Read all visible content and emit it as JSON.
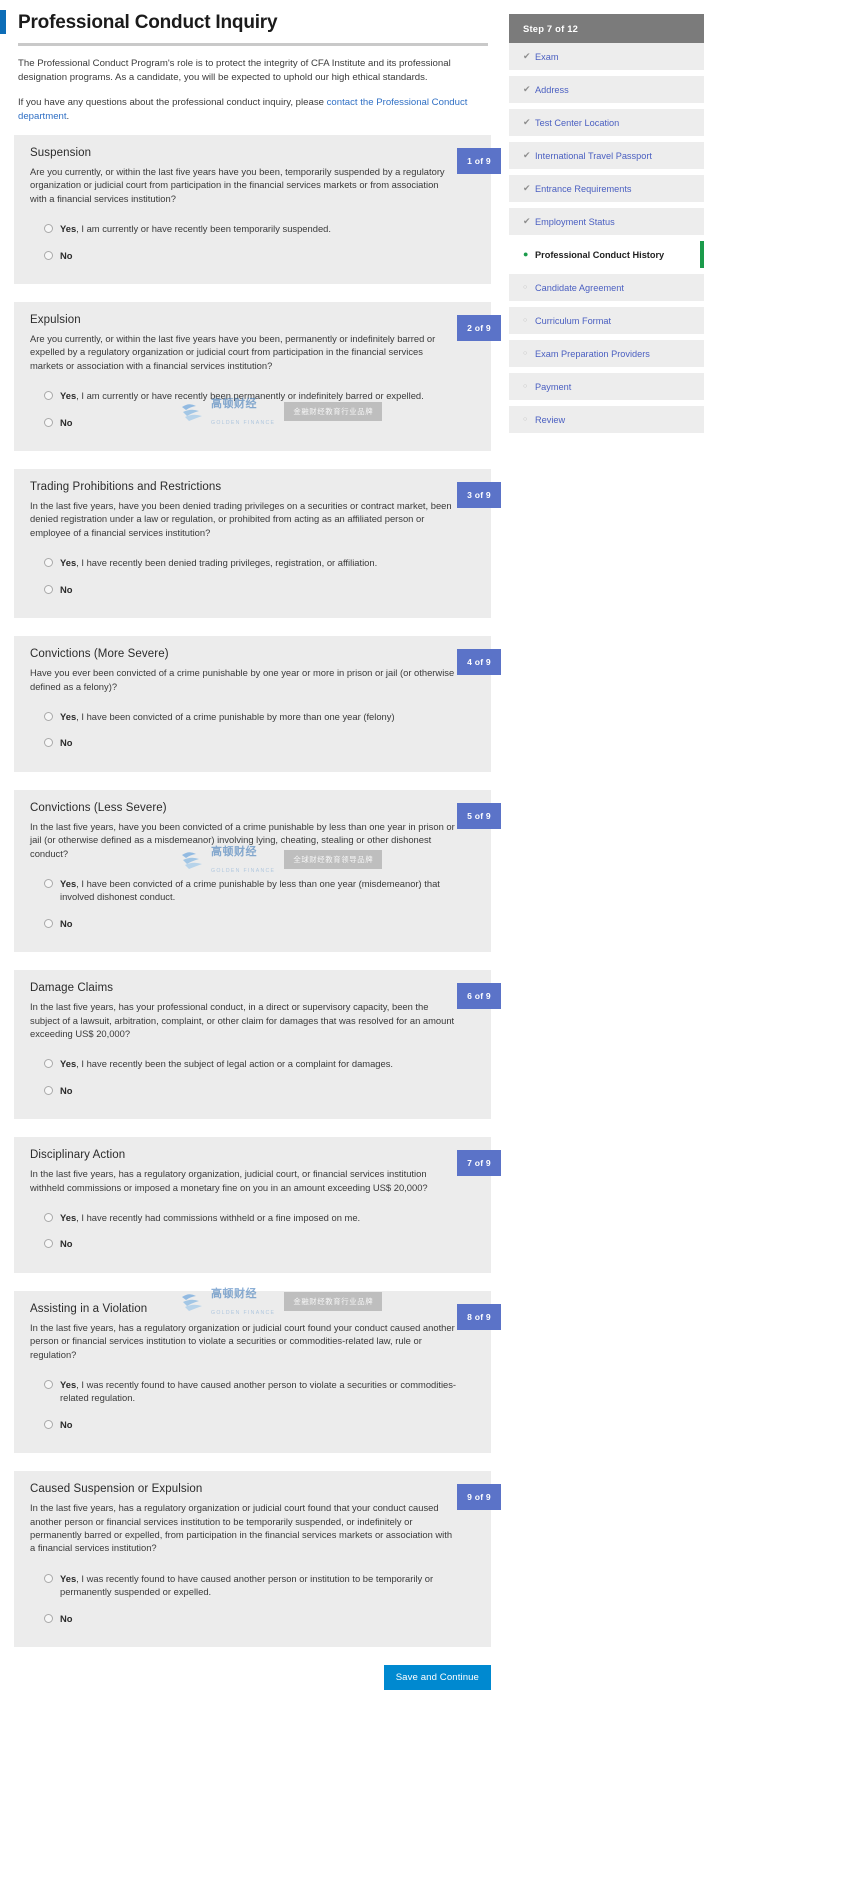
{
  "page": {
    "title": "Professional Conduct Inquiry",
    "intro_paragraph_1": "The Professional Conduct Program's role is to protect the integrity of CFA Institute and its professional designation programs. As a candidate, you will be expected to uphold our high ethical standards.",
    "intro_paragraph_2_prefix": "If you have any questions about the professional conduct inquiry, please ",
    "intro_link_text": "contact the Professional Conduct department",
    "intro_paragraph_2_suffix": "."
  },
  "questions": [
    {
      "badge": "1 of 9",
      "heading": "Suspension",
      "text": "Are you currently, or within the last five years have you been, temporarily suspended by a regulatory organization or judicial court from participation in the financial services markets or from association with a financial services institution?",
      "yes_bold": "Yes",
      "yes_rest": ", I am currently or have recently been temporarily suspended.",
      "no_label": "No"
    },
    {
      "badge": "2 of 9",
      "heading": "Expulsion",
      "text": "Are you currently, or within the last five years have you been, permanently or indefinitely barred or expelled by a regulatory organization or judicial court from participation in the financial services markets or association with a financial services institution?",
      "yes_bold": "Yes",
      "yes_rest": ", I am currently or have recently been permanently or indefinitely barred or expelled.",
      "no_label": "No"
    },
    {
      "badge": "3 of 9",
      "heading": "Trading Prohibitions and Restrictions",
      "text": "In the last five years, have you been denied trading privileges on a securities or contract market, been denied registration under a law or regulation, or prohibited from acting as an affiliated person or employee of a financial services institution?",
      "yes_bold": "Yes",
      "yes_rest": ", I have recently been denied trading privileges, registration, or affiliation.",
      "no_label": "No"
    },
    {
      "badge": "4 of 9",
      "heading": "Convictions (More Severe)",
      "text": "Have you ever been convicted of a crime punishable by one year or more in prison or jail (or otherwise defined as a felony)?",
      "yes_bold": "Yes",
      "yes_rest": ", I have been convicted of a crime punishable by more than one year (felony)",
      "no_label": "No"
    },
    {
      "badge": "5 of 9",
      "heading": "Convictions (Less Severe)",
      "text": "In the last five years, have you been convicted of a crime punishable by less than one year in prison or jail (or otherwise defined as a misdemeanor) involving lying, cheating, stealing or other dishonest conduct?",
      "yes_bold": "Yes",
      "yes_rest": ", I have been convicted of a crime punishable by less than one year (misdemeanor) that involved dishonest conduct.",
      "no_label": "No"
    },
    {
      "badge": "6 of 9",
      "heading": "Damage Claims",
      "text": "In the last five years, has your professional conduct, in a direct or supervisory capacity, been the subject of a lawsuit, arbitration, complaint, or other claim for damages that was resolved for an amount exceeding US$ 20,000?",
      "yes_bold": "Yes",
      "yes_rest": ", I have recently been the subject of legal action or a complaint for damages.",
      "no_label": "No"
    },
    {
      "badge": "7 of 9",
      "heading": "Disciplinary Action",
      "text": "In the last five years, has a regulatory organization, judicial court, or financial services institution withheld commissions or imposed a monetary fine on you in an amount exceeding US$ 20,000?",
      "yes_bold": "Yes",
      "yes_rest": ", I have recently had commissions withheld or a fine imposed on me.",
      "no_label": "No"
    },
    {
      "badge": "8 of 9",
      "heading": "Assisting in a Violation",
      "text": "In the last five years, has a regulatory organization or judicial court found your conduct caused another person or financial services institution to violate a securities or commodities-related law, rule or regulation?",
      "yes_bold": "Yes",
      "yes_rest": ", I was recently found to have caused another person to violate a securities or commodities-related regulation.",
      "no_label": "No"
    },
    {
      "badge": "9 of 9",
      "heading": "Caused Suspension or Expulsion",
      "text": "In the last five years, has a regulatory organization or judicial court found that your conduct caused another person or financial services institution to be temporarily suspended, or indefinitely or permanently barred or expelled, from participation in the financial services markets or association with a financial services institution?",
      "yes_bold": "Yes",
      "yes_rest": ", I was recently found to have caused another person or institution to be temporarily or permanently suspended or expelled.",
      "no_label": "No"
    }
  ],
  "footer": {
    "save_label": "Save and Continue"
  },
  "sidebar": {
    "step_header": "Step 7 of 12",
    "items": [
      {
        "label": "Exam",
        "state": "done",
        "icon": "check-icon"
      },
      {
        "label": "Address",
        "state": "done",
        "icon": "check-icon"
      },
      {
        "label": "Test Center Location",
        "state": "done",
        "icon": "check-icon"
      },
      {
        "label": "International Travel Passport",
        "state": "done",
        "icon": "check-icon"
      },
      {
        "label": "Entrance Requirements",
        "state": "done",
        "icon": "check-icon"
      },
      {
        "label": "Employment Status",
        "state": "done",
        "icon": "check-icon"
      },
      {
        "label": "Professional Conduct History",
        "state": "current",
        "icon": "dot-icon"
      },
      {
        "label": "Candidate Agreement",
        "state": "pending",
        "icon": "circle-icon"
      },
      {
        "label": "Curriculum Format",
        "state": "pending",
        "icon": "circle-icon"
      },
      {
        "label": "Exam Preparation Providers",
        "state": "pending",
        "icon": "circle-icon"
      },
      {
        "label": "Payment",
        "state": "pending",
        "icon": "circle-icon"
      },
      {
        "label": "Review",
        "state": "pending",
        "icon": "circle-icon"
      }
    ]
  },
  "watermarks": [
    {
      "top_text": "高顿财经",
      "sub_text": "GOLDEN FINANCE",
      "bar_text": "金融财经教育行业品牌"
    },
    {
      "top_text": "高顿财经",
      "sub_text": "GOLDEN FINANCE",
      "bar_text": "全球财经教育领导品牌"
    },
    {
      "top_text": "高顿财经",
      "sub_text": "GOLDEN FINANCE",
      "bar_text": "金融财经教育行业品牌"
    }
  ],
  "colors": {
    "badge": "#5b73c8",
    "save_button": "#0089d0",
    "step_header": "#7b7b7b",
    "current_marker": "#1b9b4b",
    "link": "#2f6fc4",
    "card_bg": "#ececec"
  }
}
